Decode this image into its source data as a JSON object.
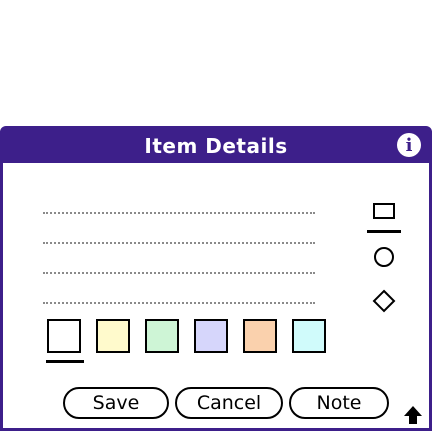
{
  "dialog": {
    "title": "Item Details",
    "info_icon": "info-icon",
    "info_symbol": "i"
  },
  "description_lines": 4,
  "shapes": [
    {
      "name": "square",
      "selected": true
    },
    {
      "name": "circle",
      "selected": false
    },
    {
      "name": "diamond",
      "selected": false
    }
  ],
  "colors": [
    {
      "hex": "#ffffff",
      "selected": true
    },
    {
      "hex": "#fffacc",
      "selected": false
    },
    {
      "hex": "#cef5d6",
      "selected": false
    },
    {
      "hex": "#d6d6fb",
      "selected": false
    },
    {
      "hex": "#fad1ad",
      "selected": false
    },
    {
      "hex": "#d0fbfb",
      "selected": false
    }
  ],
  "buttons": {
    "save": "Save",
    "cancel": "Cancel",
    "note": "Note"
  },
  "scroll_icon": "arrow-up-icon",
  "accent_color": "#3d1f8a"
}
